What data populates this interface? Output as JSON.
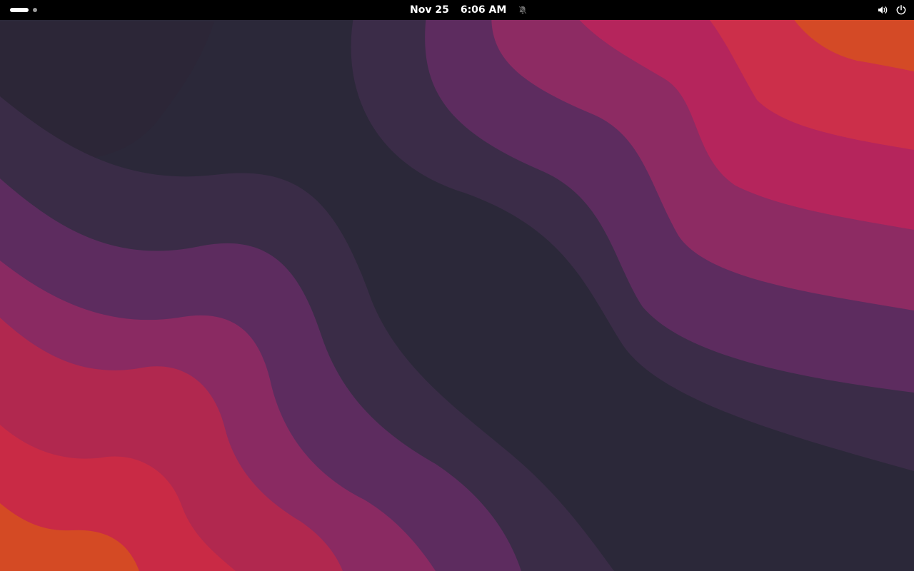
{
  "top_bar": {
    "date": "Nov 25",
    "time": "6:06 AM",
    "workspaces": {
      "count": 2,
      "active_index": 0
    },
    "icons": {
      "notifications": "notifications-disabled-icon",
      "volume": "volume-icon",
      "power": "power-icon"
    }
  },
  "wallpaper": {
    "name": "ubuntu-wave",
    "colors": [
      "#2b2839",
      "#3b2b48",
      "#5c2b5e",
      "#8a2a62",
      "#b0255a",
      "#c8284a",
      "#d84523"
    ]
  }
}
